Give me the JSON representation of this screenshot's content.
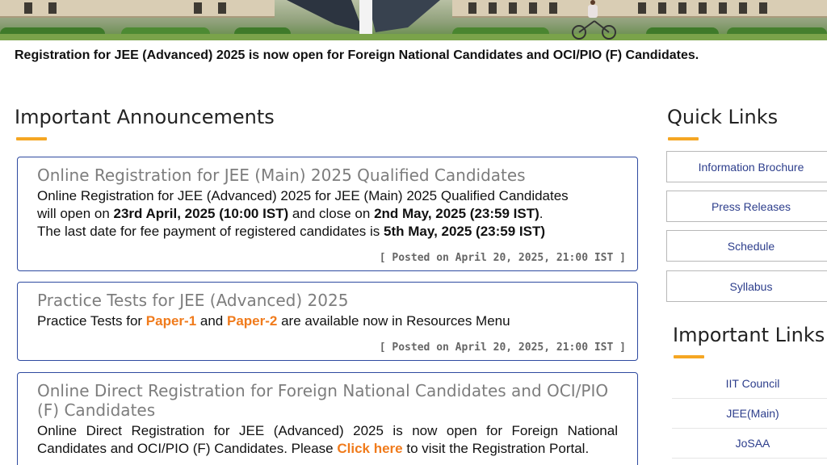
{
  "notice": {
    "text": "Registration for JEE (Advanced) 2025 is now open for Foreign National Candidates and OCI/PIO (F) Candidates."
  },
  "announcements": {
    "heading": "Important Announcements",
    "items": [
      {
        "title": "Online Registration for JEE (Main) 2025 Qualified Candidates",
        "line1": "Online Registration for JEE (Advanced) 2025 for JEE (Main) 2025 Qualified Candidates",
        "line2_a": "will open on ",
        "line2_b": "23rd April, 2025 (10:00 IST)",
        "line2_c": " and close on ",
        "line2_d": "2nd May, 2025 (23:59 IST)",
        "line2_e": ".",
        "line3_a": "The last date for fee payment of registered candidates is ",
        "line3_b": "5th May, 2025 (23:59 IST)",
        "posted": "[ Posted on April 20, 2025, 21:00 IST ]"
      },
      {
        "title": "Practice Tests for JEE (Advanced) 2025",
        "body_a": "Practice Tests for ",
        "link1": "Paper-1",
        "body_b": " and ",
        "link2": "Paper-2",
        "body_c": " are available now in Resources Menu",
        "posted": "[ Posted on April 20, 2025, 21:00 IST ]"
      },
      {
        "title": "Online Direct Registration for Foreign National Candidates and OCI/PIO (F) Candidates",
        "body_a": "Online Direct Registration for JEE (Advanced) 2025 is now open for Foreign National Candidates and OCI/PIO (F) Candidates. Please ",
        "link": "Click here",
        "body_b": " to visit the Registration Portal."
      }
    ]
  },
  "quick_links": {
    "heading": "Quick Links",
    "items": [
      "Information Brochure",
      "Press Releases",
      "Schedule",
      "Syllabus"
    ]
  },
  "important_links": {
    "heading": "Important Links",
    "items": [
      "IIT Council",
      "JEE(Main)",
      "JoSAA"
    ]
  },
  "colors": {
    "accent": "#f5a623",
    "card_border": "#2e4aa0",
    "link_orange": "#f07b1c",
    "link_blue": "#2d3e8c"
  }
}
